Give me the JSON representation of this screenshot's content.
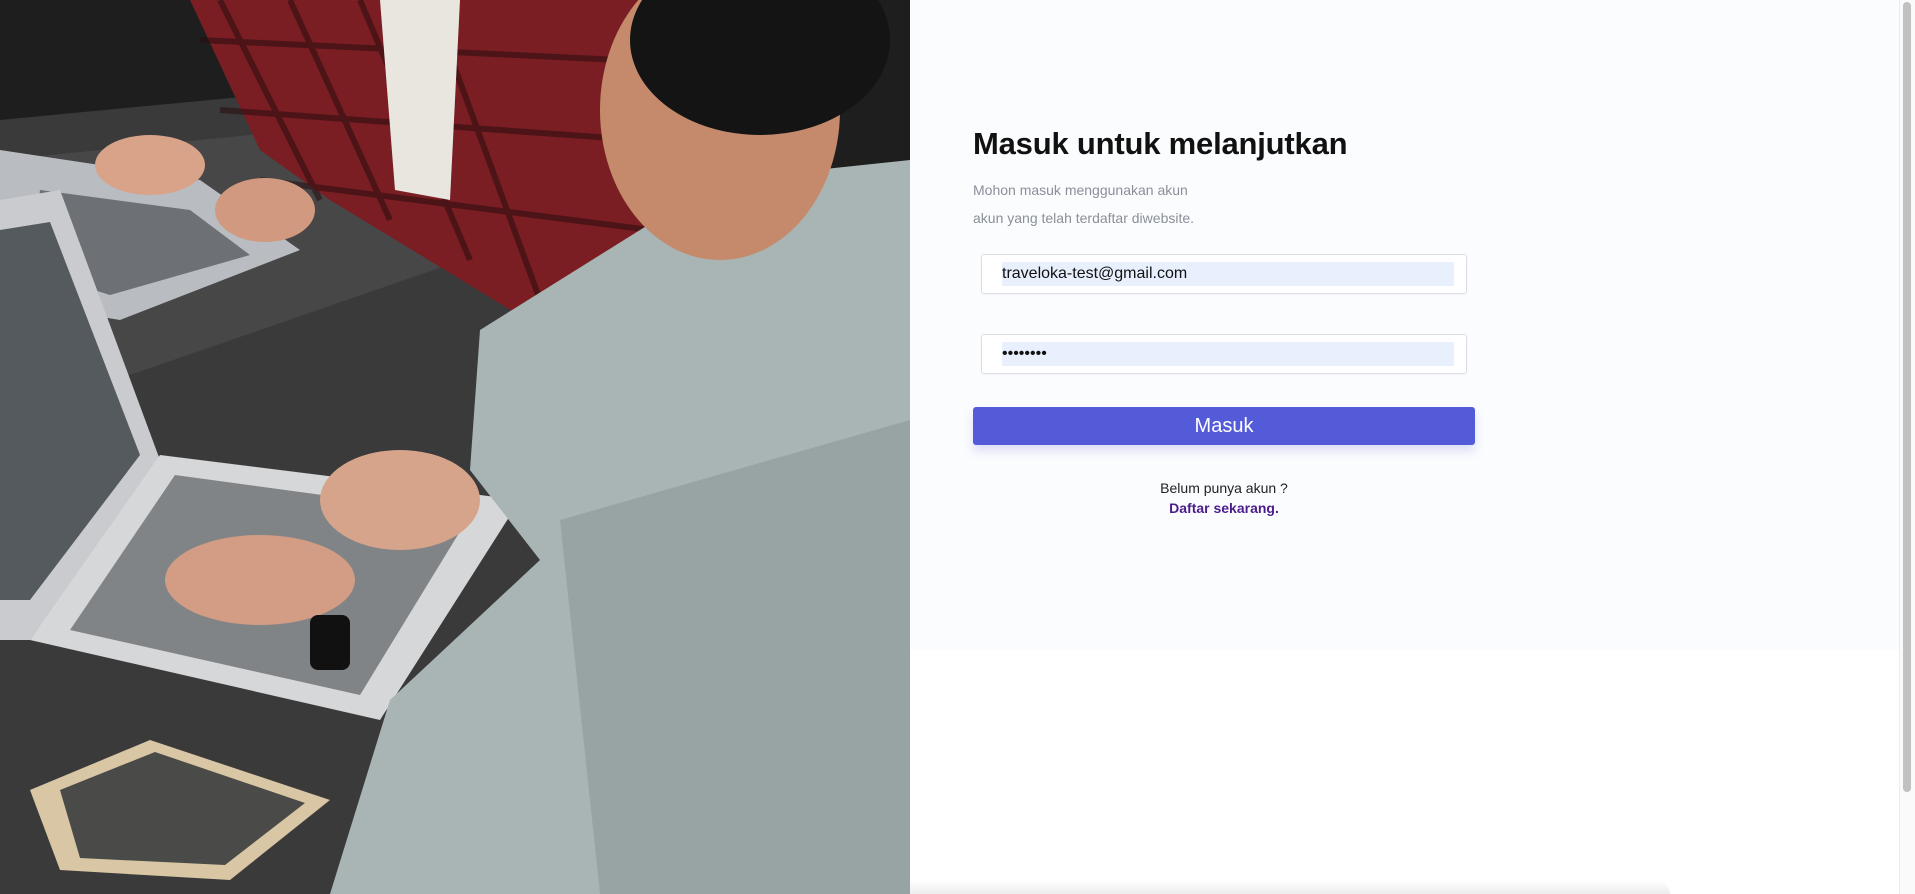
{
  "hero_image": {
    "description_icon": "laptop-meeting-photo"
  },
  "login": {
    "title": "Masuk untuk melanjutkan",
    "subtitle_line1": "Mohon masuk menggunakan akun",
    "subtitle_line2": "akun yang telah terdaftar diwebsite.",
    "email_value": "traveloka-test@gmail.com",
    "password_value": "••••••••",
    "submit_label": "Masuk",
    "register_question": "Belum punya akun ?",
    "register_link": "Daftar sekarang."
  },
  "colors": {
    "primary": "#535bd9",
    "link": "#4b1c8c",
    "autofill": "#e8f0fe"
  }
}
